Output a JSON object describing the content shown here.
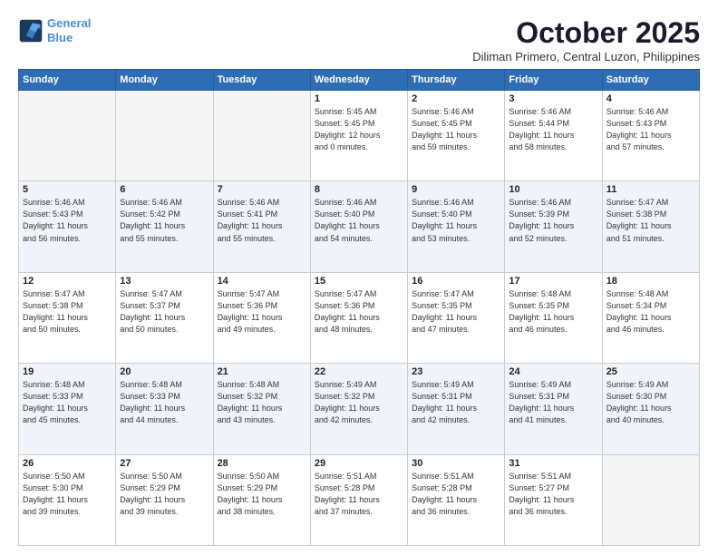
{
  "header": {
    "logo_line1": "General",
    "logo_line2": "Blue",
    "month": "October 2025",
    "location": "Diliman Primero, Central Luzon, Philippines"
  },
  "weekdays": [
    "Sunday",
    "Monday",
    "Tuesday",
    "Wednesday",
    "Thursday",
    "Friday",
    "Saturday"
  ],
  "weeks": [
    [
      {
        "day": "",
        "info": ""
      },
      {
        "day": "",
        "info": ""
      },
      {
        "day": "",
        "info": ""
      },
      {
        "day": "1",
        "info": "Sunrise: 5:45 AM\nSunset: 5:45 PM\nDaylight: 12 hours\nand 0 minutes."
      },
      {
        "day": "2",
        "info": "Sunrise: 5:46 AM\nSunset: 5:45 PM\nDaylight: 11 hours\nand 59 minutes."
      },
      {
        "day": "3",
        "info": "Sunrise: 5:46 AM\nSunset: 5:44 PM\nDaylight: 11 hours\nand 58 minutes."
      },
      {
        "day": "4",
        "info": "Sunrise: 5:46 AM\nSunset: 5:43 PM\nDaylight: 11 hours\nand 57 minutes."
      }
    ],
    [
      {
        "day": "5",
        "info": "Sunrise: 5:46 AM\nSunset: 5:43 PM\nDaylight: 11 hours\nand 56 minutes."
      },
      {
        "day": "6",
        "info": "Sunrise: 5:46 AM\nSunset: 5:42 PM\nDaylight: 11 hours\nand 55 minutes."
      },
      {
        "day": "7",
        "info": "Sunrise: 5:46 AM\nSunset: 5:41 PM\nDaylight: 11 hours\nand 55 minutes."
      },
      {
        "day": "8",
        "info": "Sunrise: 5:46 AM\nSunset: 5:40 PM\nDaylight: 11 hours\nand 54 minutes."
      },
      {
        "day": "9",
        "info": "Sunrise: 5:46 AM\nSunset: 5:40 PM\nDaylight: 11 hours\nand 53 minutes."
      },
      {
        "day": "10",
        "info": "Sunrise: 5:46 AM\nSunset: 5:39 PM\nDaylight: 11 hours\nand 52 minutes."
      },
      {
        "day": "11",
        "info": "Sunrise: 5:47 AM\nSunset: 5:38 PM\nDaylight: 11 hours\nand 51 minutes."
      }
    ],
    [
      {
        "day": "12",
        "info": "Sunrise: 5:47 AM\nSunset: 5:38 PM\nDaylight: 11 hours\nand 50 minutes."
      },
      {
        "day": "13",
        "info": "Sunrise: 5:47 AM\nSunset: 5:37 PM\nDaylight: 11 hours\nand 50 minutes."
      },
      {
        "day": "14",
        "info": "Sunrise: 5:47 AM\nSunset: 5:36 PM\nDaylight: 11 hours\nand 49 minutes."
      },
      {
        "day": "15",
        "info": "Sunrise: 5:47 AM\nSunset: 5:36 PM\nDaylight: 11 hours\nand 48 minutes."
      },
      {
        "day": "16",
        "info": "Sunrise: 5:47 AM\nSunset: 5:35 PM\nDaylight: 11 hours\nand 47 minutes."
      },
      {
        "day": "17",
        "info": "Sunrise: 5:48 AM\nSunset: 5:35 PM\nDaylight: 11 hours\nand 46 minutes."
      },
      {
        "day": "18",
        "info": "Sunrise: 5:48 AM\nSunset: 5:34 PM\nDaylight: 11 hours\nand 46 minutes."
      }
    ],
    [
      {
        "day": "19",
        "info": "Sunrise: 5:48 AM\nSunset: 5:33 PM\nDaylight: 11 hours\nand 45 minutes."
      },
      {
        "day": "20",
        "info": "Sunrise: 5:48 AM\nSunset: 5:33 PM\nDaylight: 11 hours\nand 44 minutes."
      },
      {
        "day": "21",
        "info": "Sunrise: 5:48 AM\nSunset: 5:32 PM\nDaylight: 11 hours\nand 43 minutes."
      },
      {
        "day": "22",
        "info": "Sunrise: 5:49 AM\nSunset: 5:32 PM\nDaylight: 11 hours\nand 42 minutes."
      },
      {
        "day": "23",
        "info": "Sunrise: 5:49 AM\nSunset: 5:31 PM\nDaylight: 11 hours\nand 42 minutes."
      },
      {
        "day": "24",
        "info": "Sunrise: 5:49 AM\nSunset: 5:31 PM\nDaylight: 11 hours\nand 41 minutes."
      },
      {
        "day": "25",
        "info": "Sunrise: 5:49 AM\nSunset: 5:30 PM\nDaylight: 11 hours\nand 40 minutes."
      }
    ],
    [
      {
        "day": "26",
        "info": "Sunrise: 5:50 AM\nSunset: 5:30 PM\nDaylight: 11 hours\nand 39 minutes."
      },
      {
        "day": "27",
        "info": "Sunrise: 5:50 AM\nSunset: 5:29 PM\nDaylight: 11 hours\nand 39 minutes."
      },
      {
        "day": "28",
        "info": "Sunrise: 5:50 AM\nSunset: 5:29 PM\nDaylight: 11 hours\nand 38 minutes."
      },
      {
        "day": "29",
        "info": "Sunrise: 5:51 AM\nSunset: 5:28 PM\nDaylight: 11 hours\nand 37 minutes."
      },
      {
        "day": "30",
        "info": "Sunrise: 5:51 AM\nSunset: 5:28 PM\nDaylight: 11 hours\nand 36 minutes."
      },
      {
        "day": "31",
        "info": "Sunrise: 5:51 AM\nSunset: 5:27 PM\nDaylight: 11 hours\nand 36 minutes."
      },
      {
        "day": "",
        "info": ""
      }
    ]
  ]
}
